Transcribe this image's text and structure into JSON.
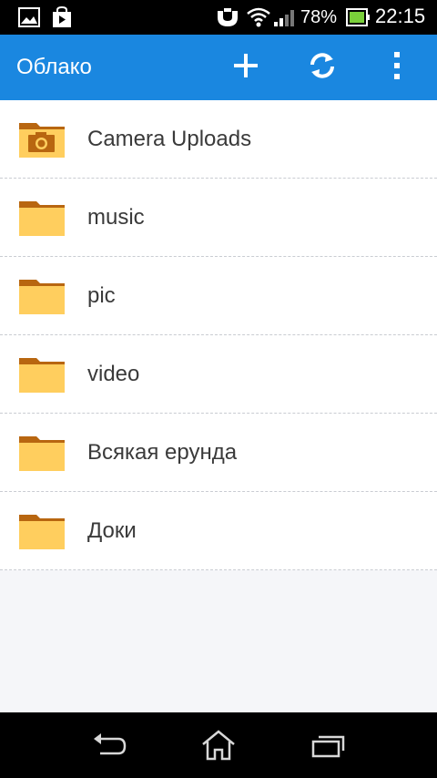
{
  "status_bar": {
    "battery_percent": "78%",
    "time": "22:15",
    "icons": [
      "gallery-icon",
      "store-icon",
      "headset-icon",
      "wifi-icon",
      "signal-icon",
      "battery-icon"
    ]
  },
  "app_bar": {
    "title": "Облако",
    "actions": [
      "add-icon",
      "sync-icon",
      "more-vert-icon"
    ],
    "accent_color": "#1a87e0"
  },
  "folders": [
    {
      "name": "Camera Uploads",
      "icon": "camera-folder-icon"
    },
    {
      "name": "music",
      "icon": "folder-icon"
    },
    {
      "name": "pic",
      "icon": "folder-icon"
    },
    {
      "name": "video",
      "icon": "folder-icon"
    },
    {
      "name": "Всякая ерунда",
      "icon": "folder-icon"
    },
    {
      "name": "Доки",
      "icon": "folder-icon"
    }
  ],
  "nav_bar": {
    "buttons": [
      "back-icon",
      "home-icon",
      "recent-apps-icon"
    ]
  }
}
